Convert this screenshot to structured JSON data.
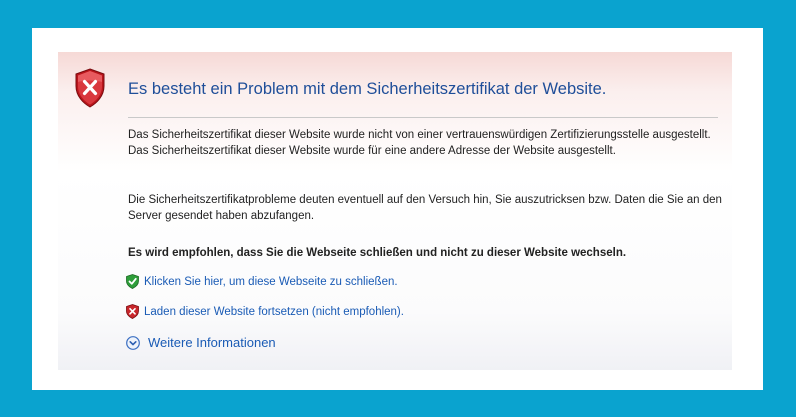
{
  "page": {
    "title": "Es besteht ein Problem mit dem Sicherheitszertifikat der Website.",
    "para1": "Das Sicherheitszertifikat dieser Website wurde nicht von einer vertrauenswürdigen Zertifizierungsstelle ausgestellt.",
    "para1b": "Das Sicherheitszertifikat dieser Website wurde für eine andere Adresse der Website ausgestellt.",
    "para2": "Die Sicherheitszertifikatprobleme deuten eventuell auf den Versuch hin, Sie auszutricksen bzw. Daten die Sie an den Server gesendet haben abzufangen.",
    "recommendation": "Es wird empfohlen, dass Sie die Webseite schließen und nicht zu dieser Website wechseln.",
    "close_link": "Klicken Sie hier, um diese Webseite zu schließen.",
    "continue_link": "Laden dieser Website fortsetzen (nicht empfohlen).",
    "more_info": "Weitere Informationen"
  },
  "icons": {
    "header": "error-shield-icon",
    "close": "green-shield-check-icon",
    "continue": "red-shield-x-icon",
    "more": "expand-chevron-icon"
  },
  "colors": {
    "border": "#0aa3cf",
    "title": "#1f4e99",
    "link": "#1a5bb5",
    "error": "#c8262b",
    "safe": "#2e9e3a"
  }
}
